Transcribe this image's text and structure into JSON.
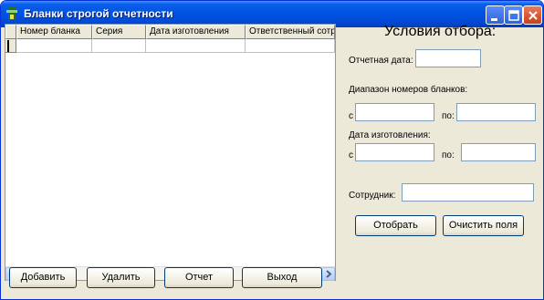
{
  "window": {
    "title": "Бланки строгой отчетности"
  },
  "grid": {
    "columns": [
      "Номер бланка",
      "Серия",
      "Дата изготовления",
      "Ответственный сотр"
    ],
    "rows": []
  },
  "buttons": {
    "add": "Добавить",
    "delete": "Удалить",
    "report": "Отчет",
    "exit": "Выход"
  },
  "filter": {
    "heading": "Условия отбора:",
    "report_date_label": "Отчетная дата:",
    "report_date_value": "",
    "range_label": "Диапазон номеров бланков:",
    "range_from_label": "с",
    "range_from_value": "",
    "range_to_label": "по:",
    "range_to_value": "",
    "manufacture_label": "Дата изготовления:",
    "manufacture_from_label": "с",
    "manufacture_from_value": "",
    "manufacture_to_label": "по:",
    "manufacture_to_value": "",
    "employee_label": "Сотрудник:",
    "employee_value": "",
    "select_button": "Отобрать",
    "clear_button": "Очистить поля"
  }
}
